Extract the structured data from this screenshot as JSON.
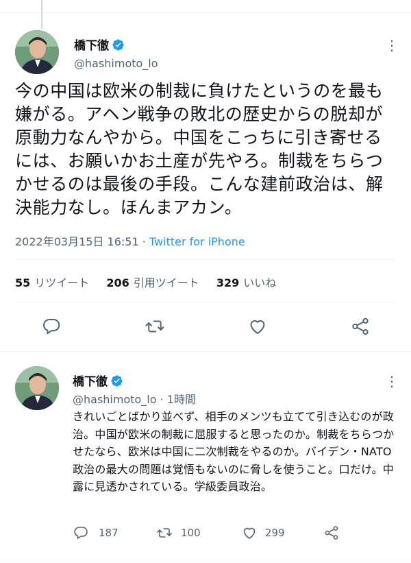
{
  "main_tweet": {
    "display_name": "橋下徹",
    "handle": "@hashimoto_lo",
    "text": "今の中国は欧米の制裁に負けたというのを最も嫌がる。アヘン戦争の敗北の歴史からの脱却が原動力なんやから。中国をこっちに引き寄せるには、お願いかお土産が先やろ。制裁をちらつかせるのは最後の手段。こんな建前政治は、解決能力なし。ほんまアカン。",
    "datetime": "2022年03月15日 16:51",
    "separator": " · ",
    "source": "Twitter for iPhone",
    "stats": {
      "retweets_count": "55",
      "retweets_label": "リツイート",
      "quotes_count": "206",
      "quotes_label": "引用ツイート",
      "likes_count": "329",
      "likes_label": "いいね"
    },
    "more_glyph": "⋮"
  },
  "reply_tweet": {
    "display_name": "橋下徹",
    "handle": "@hashimoto_lo",
    "time": " · 1時間",
    "text": "きれいごとばかり並べず、相手のメンツも立てて引き込むのが政治。中国が欧米の制裁に屈服すると思ったのか。制裁をちらつかせたなら、欧米は中国に二次制裁をやるのか。バイデン・NATO政治の最大の問題は覚悟もないのに脅しを使うこと。口だけ。中露に見透かされている。学級委員政治。",
    "reply_count": "187",
    "retweet_count": "100",
    "like_count": "299",
    "more_glyph": "⋮"
  },
  "colors": {
    "verified": "#1d9bf0",
    "link": "#1d9bf0",
    "secondary_text": "#536471",
    "divider": "#eff3f4"
  },
  "icons": [
    "verified-badge-icon",
    "reply-icon",
    "retweet-icon",
    "like-icon",
    "share-icon",
    "more-icon"
  ]
}
